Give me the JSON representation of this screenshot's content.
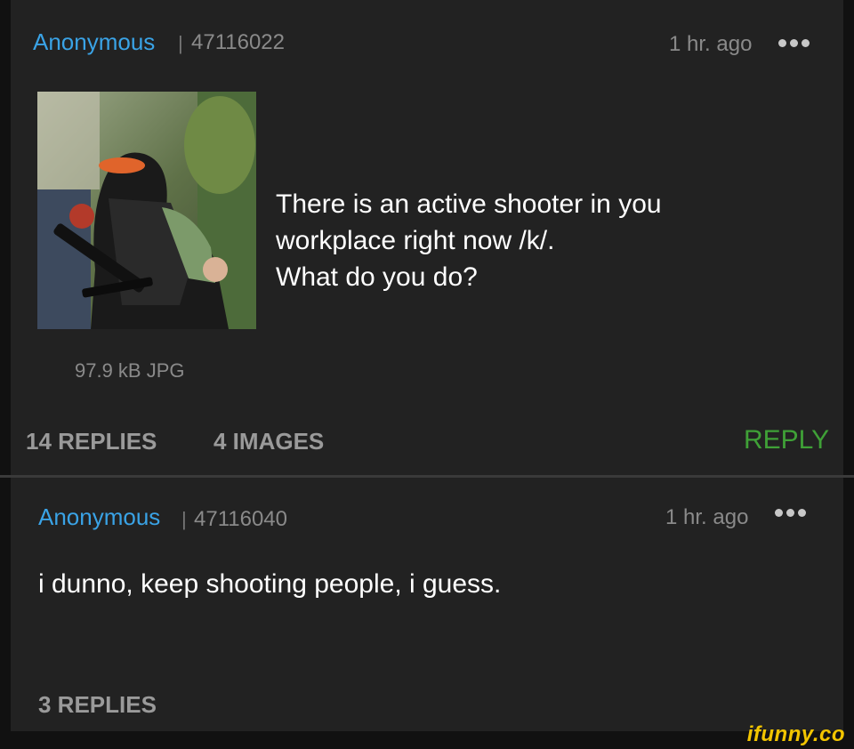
{
  "op": {
    "author": "Anonymous",
    "separator": "|",
    "post_number": "47116022",
    "time": "1 hr. ago",
    "menu_icon": "more-dots-icon",
    "text": "There is an active shooter in you\nworkplace right now /k/.\nWhat do you do?",
    "image_file": "97.9 kB JPG",
    "replies_label": "14 REPLIES",
    "images_label": "4 IMAGES",
    "reply_button": "REPLY"
  },
  "reply": {
    "author": "Anonymous",
    "separator": "|",
    "post_number": "47116040",
    "time": "1 hr. ago",
    "menu_icon": "more-dots-icon",
    "text": "i dunno, keep shooting people, i guess.",
    "replies_label": "3 REPLIES"
  },
  "watermark": "ifunny.co",
  "colors": {
    "name": "#3aa3e6",
    "reply_button": "#3fa037",
    "watermark": "#f2c500",
    "background": "#222222"
  }
}
